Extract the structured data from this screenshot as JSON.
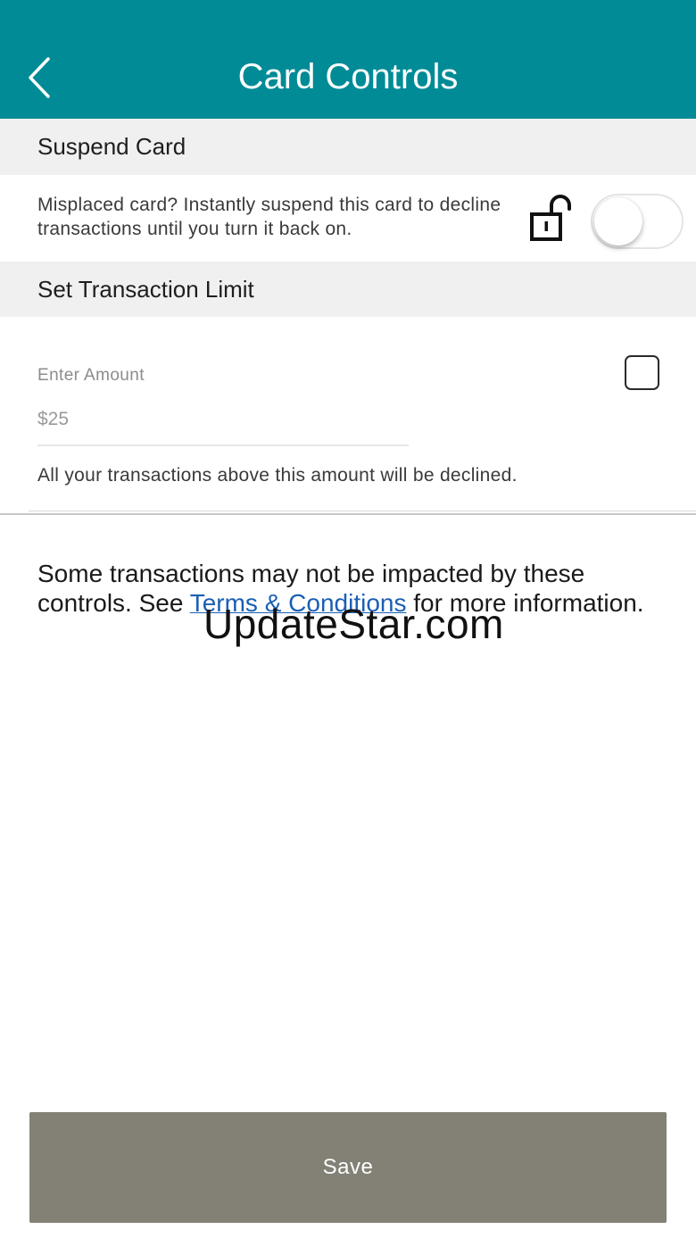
{
  "header": {
    "title": "Card Controls",
    "back_icon": "chevron-left-icon",
    "background_color": "#008b96"
  },
  "suspend": {
    "section_title": "Suspend Card",
    "description": "Misplaced card? Instantly suspend this card to decline transactions until you turn it back on.",
    "lock_icon": "lock-open-icon",
    "toggle_on": false
  },
  "limit": {
    "section_title": "Set Transaction Limit",
    "input_label": "Enter Amount",
    "input_placeholder": "$25",
    "checkbox_checked": false,
    "note": "All your transactions above this amount will be declined."
  },
  "disclaimer": {
    "text_before": "Some transactions may not be impacted by these controls. See ",
    "link_text": "Terms & Conditions",
    "text_after": " for more information.",
    "link_color": "#1a5fb4"
  },
  "watermark": {
    "text": "UpdateStar.com"
  },
  "save_button": {
    "label": "Save",
    "color": "#838176"
  }
}
